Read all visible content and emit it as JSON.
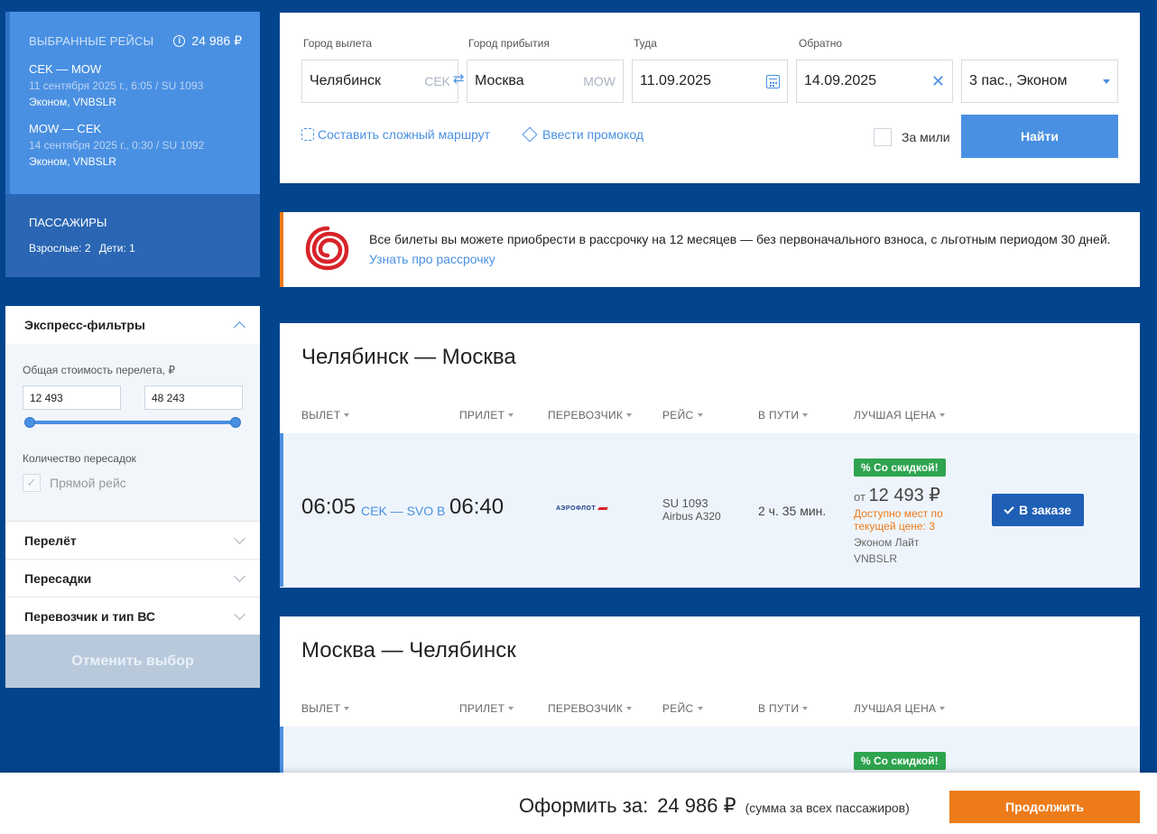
{
  "selected": {
    "title": "ВЫБРАННЫЕ РЕЙСЫ",
    "price": "24 986 ₽",
    "segments": [
      {
        "route": "CEK — MOW",
        "date": "11 сентября 2025 г., 6:05 / SU 1093",
        "fare": "Эконом, VNBSLR"
      },
      {
        "route": "MOW — CEK",
        "date": "14 сентября 2025 г., 0:30 / SU 1092",
        "fare": "Эконом, VNBSLR"
      }
    ]
  },
  "passengers": {
    "title": "ПАССАЖИРЫ",
    "adults": "Взрослые: 2",
    "children": "Дети: 1"
  },
  "filters": {
    "title": "Экспресс-фильтры",
    "price_label": "Общая стоимость перелета, ₽",
    "price_min": "12 493",
    "price_max": "48 243",
    "stops_label": "Количество пересадок",
    "direct": "Прямой рейс",
    "sections": [
      "Перелёт",
      "Пересадки",
      "Перевозчик и тип ВС"
    ],
    "reset": "Отменить выбор"
  },
  "search": {
    "from_label": "Город вылета",
    "from_value": "Челябинск",
    "from_code": "CEK",
    "to_label": "Город прибытия",
    "to_value": "Москва",
    "to_code": "MOW",
    "depart_label": "Туда",
    "depart_value": "11.09.2025",
    "return_label": "Обратно",
    "return_value": "14.09.2025",
    "pax_value": "3 пас., Эконом",
    "complex_route": "Составить сложный маршрут",
    "promo": "Ввести промокод",
    "miles": "За мили",
    "find": "Найти"
  },
  "banner": {
    "text": "Все билеты вы можете приобрести в рассрочку на 12 месяцев — без первоначального взноса, с льготным периодом 30 дней.",
    "link": "Узнать про рассрочку"
  },
  "columns": [
    "ВЫЛЕТ",
    "ПРИЛЕТ",
    "ПЕРЕВОЗЧИК",
    "РЕЙС",
    "В ПУТИ",
    "ЛУЧШАЯ ЦЕНА"
  ],
  "outbound": {
    "title": "Челябинск — Москва",
    "dep_time": "06:05",
    "codes": "CEK — SVO B",
    "arr_time": "06:40",
    "carrier": "АЭРОФЛОТ",
    "flight": "SU 1093",
    "aircraft": "Airbus A320",
    "duration": "2 ч. 35 мин.",
    "badge": "% Со скидкой!",
    "price_prefix": "от",
    "price": "12 493 ₽",
    "availability": "Доступно мест по текущей цене: 3",
    "fare_name": "Эконом Лайт",
    "fare_code": "VNBSLR",
    "action": "В заказе"
  },
  "inbound": {
    "title": "Москва — Челябинск",
    "badge": "% Со скидкой!"
  },
  "footer": {
    "label": "Оформить за:",
    "total": "24 986 ₽",
    "note": "(сумма за всех пассажиров)",
    "continue": "Продолжить"
  },
  "colors": {
    "background": "#02458d",
    "accent": "#4a90e2",
    "orange": "#ed7b1a",
    "discount": "#2ea44f"
  }
}
